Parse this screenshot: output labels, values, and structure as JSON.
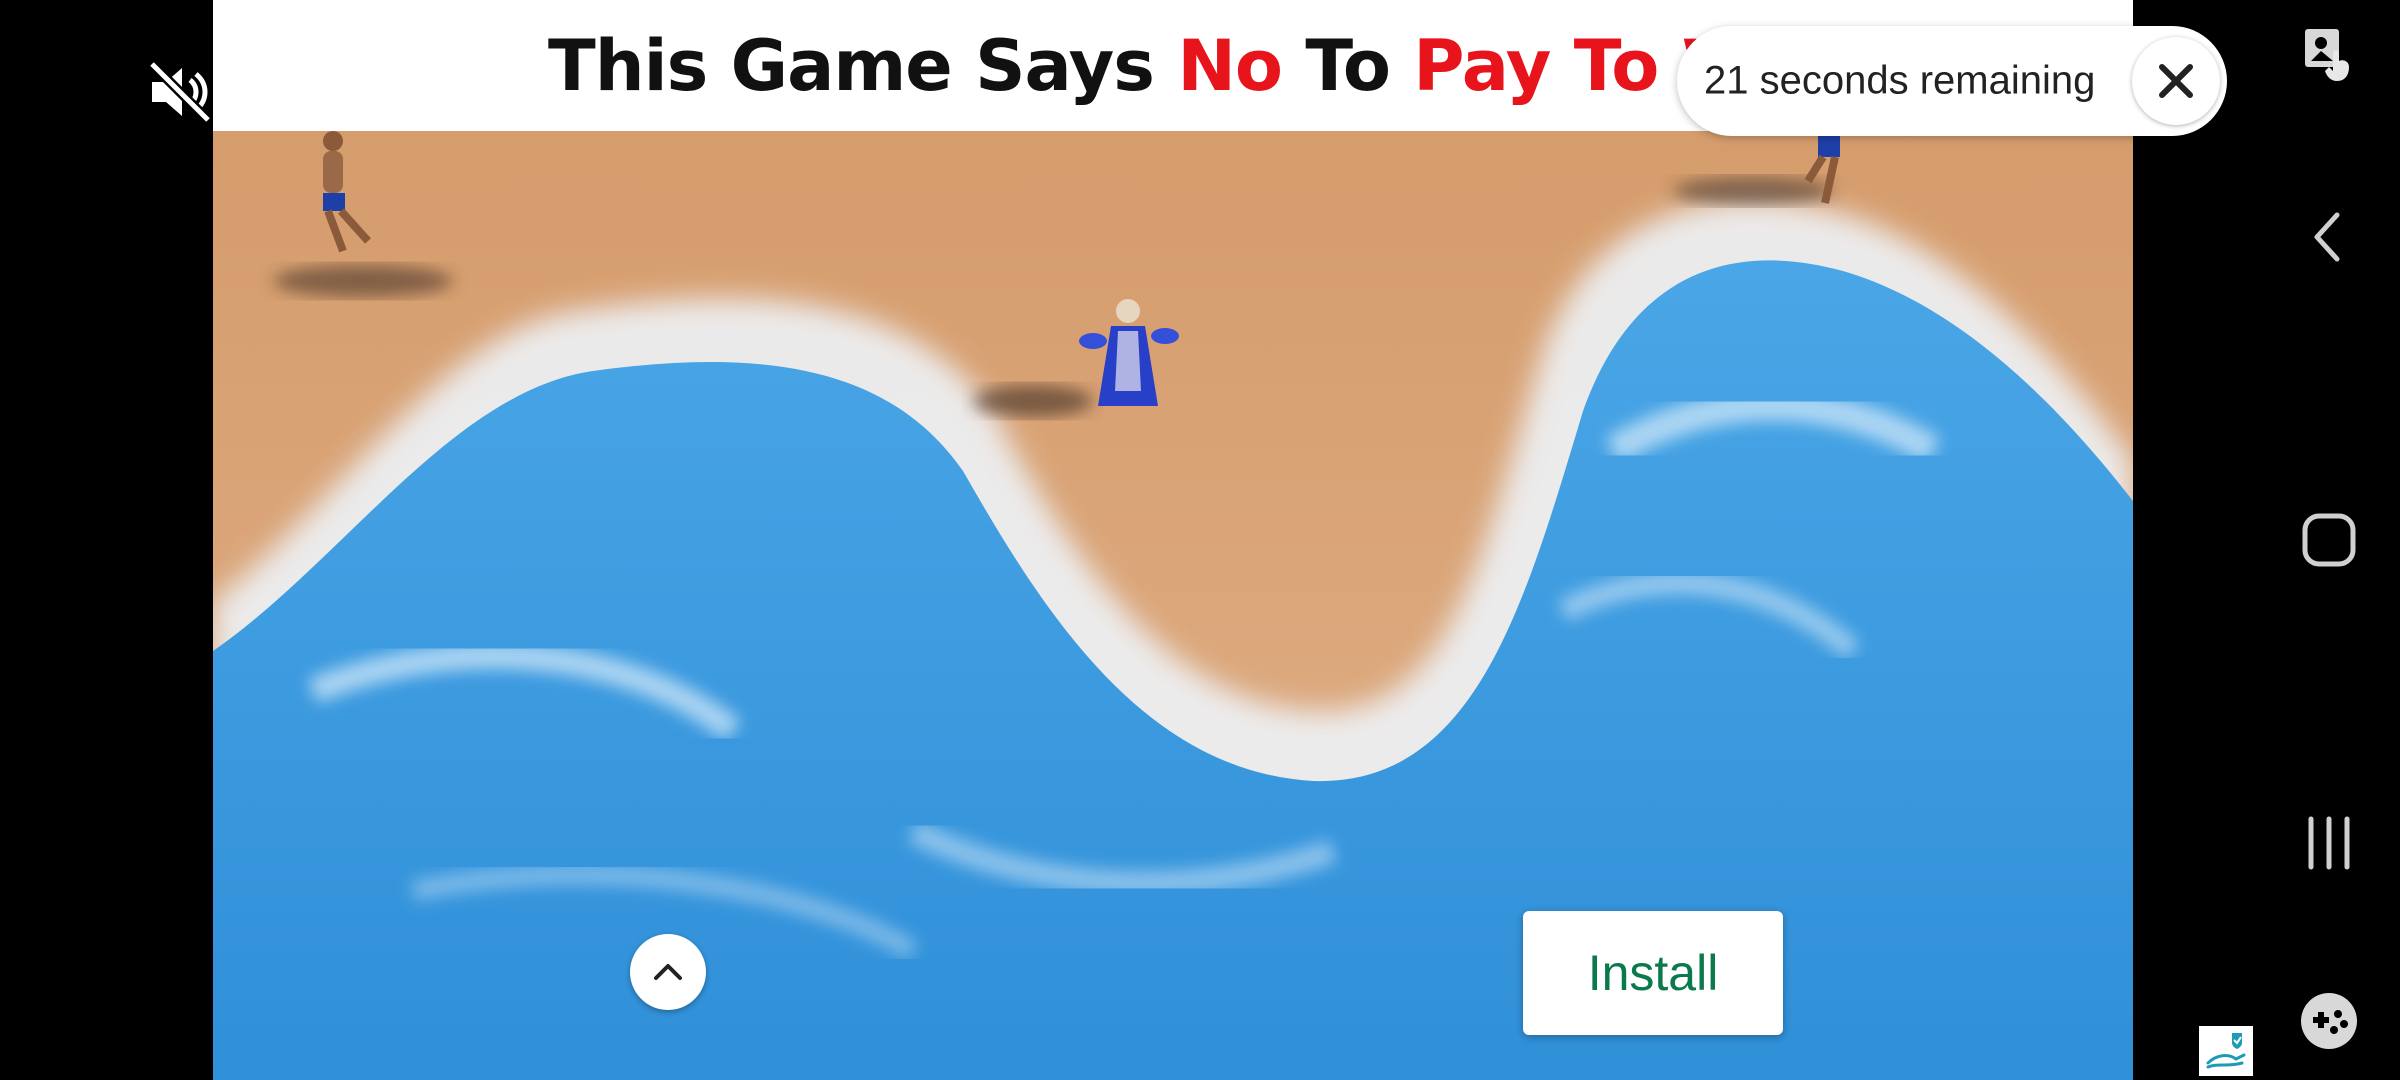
{
  "ad": {
    "banner": {
      "part1": "This Game Says ",
      "part2": "No",
      "part3": " To ",
      "part4": "Pay To W"
    },
    "countdown": "21 seconds remaining",
    "install_label": "Install"
  },
  "icons": {
    "mute": "volume-muted-icon",
    "close": "close-icon",
    "scroll_up": "chevron-up-icon",
    "adchoices": "adchoices-icon"
  },
  "navigation": {
    "items": [
      {
        "name": "screenshot-icon"
      },
      {
        "name": "back-icon"
      },
      {
        "name": "home-icon"
      },
      {
        "name": "recent-apps-icon"
      },
      {
        "name": "game-launcher-icon"
      }
    ]
  },
  "colors": {
    "banner_accent": "#e8141c",
    "install_text": "#0b7a4b",
    "sea": "#3a9be0",
    "sand": "#d9a476"
  }
}
